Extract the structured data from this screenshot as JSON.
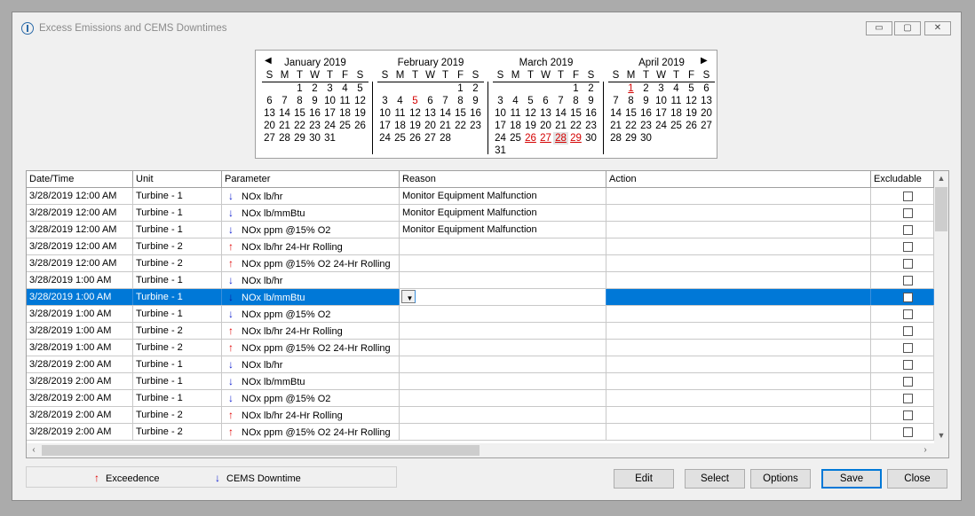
{
  "window": {
    "title": "Excess Emissions and CEMS Downtimes"
  },
  "window_controls": {
    "minimize": "▭",
    "maximize": "▢",
    "close": "✕"
  },
  "calendar": {
    "prev": "◀",
    "next": "▶",
    "dow": [
      "S",
      "M",
      "T",
      "W",
      "T",
      "F",
      "S"
    ],
    "months": [
      {
        "title": "January 2019",
        "weeks": [
          [
            "",
            "",
            "1",
            "2",
            "3",
            "4",
            "5"
          ],
          [
            "6",
            "7",
            "8",
            "9",
            "10",
            "11",
            "12"
          ],
          [
            "13",
            "14",
            "15",
            "16",
            "17",
            "18",
            "19"
          ],
          [
            "20",
            "21",
            "22",
            "23",
            "24",
            "25",
            "26"
          ],
          [
            "27",
            "28",
            "29",
            "30",
            "31",
            "",
            ""
          ]
        ]
      },
      {
        "title": "February 2019",
        "weeks": [
          [
            "",
            "",
            "",
            "",
            "",
            "1",
            "2"
          ],
          [
            "3",
            "4",
            "5",
            "6",
            "7",
            "8",
            "9"
          ],
          [
            "10",
            "11",
            "12",
            "13",
            "14",
            "15",
            "16"
          ],
          [
            "17",
            "18",
            "19",
            "20",
            "21",
            "22",
            "23"
          ],
          [
            "24",
            "25",
            "26",
            "27",
            "28",
            "",
            ""
          ]
        ]
      },
      {
        "title": "March 2019",
        "weeks": [
          [
            "",
            "",
            "",
            "",
            "",
            "1",
            "2"
          ],
          [
            "3",
            "4",
            "5",
            "6",
            "7",
            "8",
            "9"
          ],
          [
            "10",
            "11",
            "12",
            "13",
            "14",
            "15",
            "16"
          ],
          [
            "17",
            "18",
            "19",
            "20",
            "21",
            "22",
            "23"
          ],
          [
            "24",
            "25",
            "26",
            "27",
            "28",
            "29",
            "30"
          ],
          [
            "31",
            "",
            "",
            "",
            "",
            "",
            ""
          ]
        ]
      },
      {
        "title": "April 2019",
        "weeks": [
          [
            "",
            "1",
            "2",
            "3",
            "4",
            "5",
            "6"
          ],
          [
            "7",
            "8",
            "9",
            "10",
            "11",
            "12",
            "13"
          ],
          [
            "14",
            "15",
            "16",
            "17",
            "18",
            "19",
            "20"
          ],
          [
            "21",
            "22",
            "23",
            "24",
            "25",
            "26",
            "27"
          ],
          [
            "28",
            "29",
            "30",
            "",
            "",
            "",
            ""
          ]
        ]
      }
    ]
  },
  "grid": {
    "columns": [
      "Date/Time",
      "Unit",
      "Parameter",
      "Reason",
      "Action",
      "Excludable"
    ],
    "rows": [
      {
        "dt": "3/28/2019 12:00 AM",
        "unit": "Turbine - 1",
        "dir": "down",
        "param": "NOx lb/hr",
        "reason": "Monitor Equipment Malfunction",
        "action": ""
      },
      {
        "dt": "3/28/2019 12:00 AM",
        "unit": "Turbine - 1",
        "dir": "down",
        "param": "NOx lb/mmBtu",
        "reason": "Monitor Equipment Malfunction",
        "action": ""
      },
      {
        "dt": "3/28/2019 12:00 AM",
        "unit": "Turbine - 1",
        "dir": "down",
        "param": "NOx ppm @15% O2",
        "reason": "Monitor Equipment Malfunction",
        "action": ""
      },
      {
        "dt": "3/28/2019 12:00 AM",
        "unit": "Turbine - 2",
        "dir": "up",
        "param": "NOx lb/hr 24-Hr Rolling",
        "reason": "",
        "action": ""
      },
      {
        "dt": "3/28/2019 12:00 AM",
        "unit": "Turbine - 2",
        "dir": "up",
        "param": "NOx ppm @15% O2 24-Hr Rolling",
        "reason": "",
        "action": ""
      },
      {
        "dt": "3/28/2019 1:00 AM",
        "unit": "Turbine - 1",
        "dir": "down",
        "param": "NOx lb/hr",
        "reason": "",
        "action": ""
      },
      {
        "dt": "3/28/2019 1:00 AM",
        "unit": "Turbine - 1",
        "dir": "down",
        "param": "NOx lb/mmBtu",
        "reason": "",
        "action": "",
        "selected": true
      },
      {
        "dt": "3/28/2019 1:00 AM",
        "unit": "Turbine - 1",
        "dir": "down",
        "param": "NOx ppm @15% O2",
        "reason": "",
        "action": ""
      },
      {
        "dt": "3/28/2019 1:00 AM",
        "unit": "Turbine - 2",
        "dir": "up",
        "param": "NOx lb/hr 24-Hr Rolling",
        "reason": "",
        "action": ""
      },
      {
        "dt": "3/28/2019 1:00 AM",
        "unit": "Turbine - 2",
        "dir": "up",
        "param": "NOx ppm @15% O2 24-Hr Rolling",
        "reason": "",
        "action": ""
      },
      {
        "dt": "3/28/2019 2:00 AM",
        "unit": "Turbine - 1",
        "dir": "down",
        "param": "NOx lb/hr",
        "reason": "",
        "action": ""
      },
      {
        "dt": "3/28/2019 2:00 AM",
        "unit": "Turbine - 1",
        "dir": "down",
        "param": "NOx lb/mmBtu",
        "reason": "",
        "action": ""
      },
      {
        "dt": "3/28/2019 2:00 AM",
        "unit": "Turbine - 1",
        "dir": "down",
        "param": "NOx ppm @15% O2",
        "reason": "",
        "action": ""
      },
      {
        "dt": "3/28/2019 2:00 AM",
        "unit": "Turbine - 2",
        "dir": "up",
        "param": "NOx lb/hr 24-Hr Rolling",
        "reason": "",
        "action": ""
      },
      {
        "dt": "3/28/2019 2:00 AM",
        "unit": "Turbine - 2",
        "dir": "up",
        "param": "NOx ppm @15% O2 24-Hr Rolling",
        "reason": "",
        "action": ""
      }
    ]
  },
  "icons": {
    "up": "🡑",
    "down": "🡓",
    "up_text": "↑",
    "down_text": "↓"
  },
  "legend": {
    "exceedence": "Exceedence",
    "downtime": "CEMS Downtime"
  },
  "buttons": {
    "edit": "Edit",
    "select": "Select",
    "options": "Options",
    "save": "Save",
    "close": "Close"
  },
  "colors": {
    "selection": "#0078d7",
    "exceedence_arrow": "#e00000",
    "downtime_arrow": "#1020d0",
    "calendar_highlight": "#d40000"
  }
}
